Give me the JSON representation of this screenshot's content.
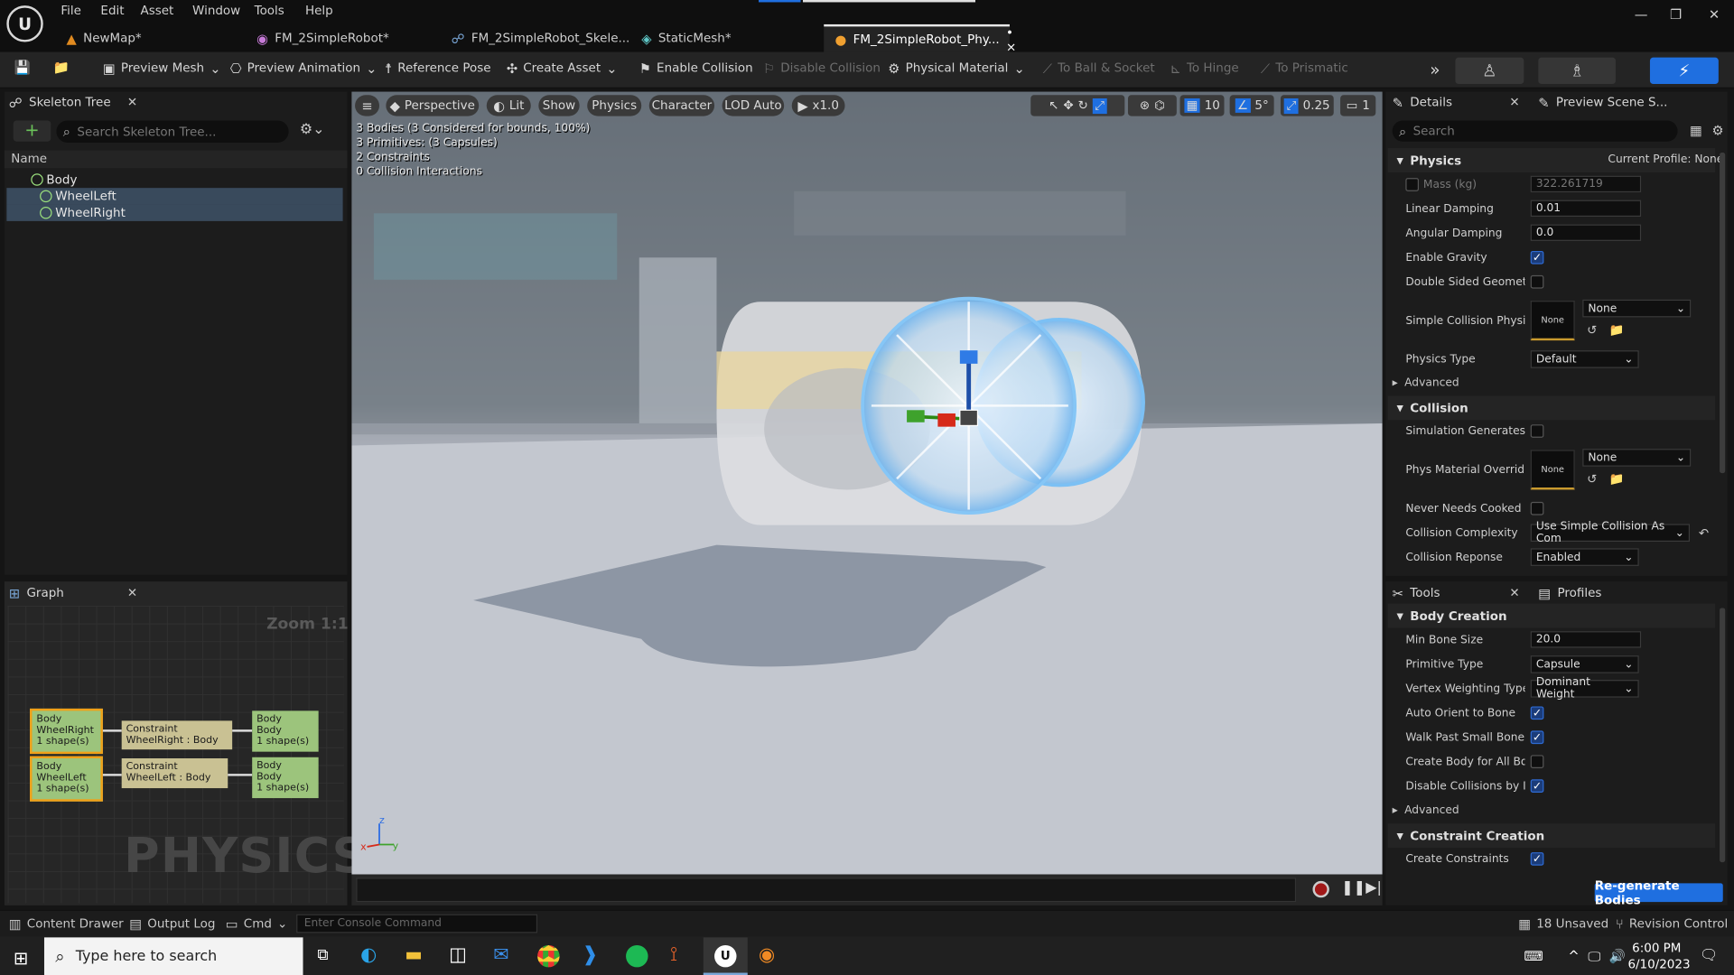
{
  "menu": [
    "File",
    "Edit",
    "Asset",
    "Window",
    "Tools",
    "Help"
  ],
  "doc_tabs": [
    {
      "label": "NewMap*",
      "icon": "map-icon",
      "active": false
    },
    {
      "label": "FM_2SimpleRobot*",
      "icon": "blueprint-icon",
      "active": false
    },
    {
      "label": "FM_2SimpleRobot_Skele...",
      "icon": "skeleton-icon",
      "active": false
    },
    {
      "label": "StaticMesh*",
      "icon": "staticmesh-icon",
      "active": false
    },
    {
      "label": "FM_2SimpleRobot_Phy...",
      "icon": "physics-asset-icon",
      "active": true,
      "suffix": "• ×"
    }
  ],
  "toolbar": {
    "preview_mesh": "Preview Mesh",
    "preview_animation": "Preview Animation",
    "reference_pose": "Reference Pose",
    "create_asset": "Create Asset",
    "enable_collision": "Enable Collision",
    "disable_collision": "Disable Collision",
    "physical_material": "Physical Material",
    "to_ball_socket": "To Ball & Socket",
    "to_hinge": "To Hinge",
    "to_prismatic": "To Prismatic"
  },
  "skeleton": {
    "tab": "Skeleton Tree",
    "search_placeholder": "Search Skeleton Tree...",
    "header": "Name",
    "bones": [
      {
        "name": "Body",
        "selected": false,
        "indent": 0
      },
      {
        "name": "WheelLeft",
        "selected": true,
        "indent": 1
      },
      {
        "name": "WheelRight",
        "selected": true,
        "indent": 1
      }
    ]
  },
  "graph": {
    "tab": "Graph",
    "zoom": "Zoom 1:1",
    "watermark": "PHYSICS",
    "rows": [
      {
        "left": [
          "Body",
          "WheelRight",
          "1 shape(s)"
        ],
        "mid": [
          "Constraint",
          "WheelRight : Body"
        ],
        "right": [
          "Body",
          "Body",
          "1 shape(s)"
        ]
      },
      {
        "left": [
          "Body",
          "WheelLeft",
          "1 shape(s)"
        ],
        "mid": [
          "Constraint",
          "WheelLeft : Body"
        ],
        "right": [
          "Body",
          "Body",
          "1 shape(s)"
        ]
      }
    ]
  },
  "viewport": {
    "perspective": "Perspective",
    "lit": "Lit",
    "show": "Show",
    "physics": "Physics",
    "character": "Character",
    "lod": "LOD Auto",
    "speed": "x1.0",
    "grid": "10",
    "angle": "5°",
    "scale": "0.25",
    "camera": "1",
    "stats": [
      "3 Bodies (3 Considered for bounds, 100%)",
      "3 Primitives: (3 Capsules)",
      "2 Constraints",
      "0 Collision Interactions"
    ]
  },
  "details": {
    "tab": "Details",
    "tab2": "Preview Scene S...",
    "search_placeholder": "Search",
    "physics_section": "Physics",
    "current_profile": "Current Profile: None",
    "mass_label": "Mass (kg)",
    "mass_value": "322.261719",
    "linear_damping_label": "Linear Damping",
    "linear_damping": "0.01",
    "angular_damping_label": "Angular Damping",
    "angular_damping": "0.0",
    "enable_gravity_label": "Enable Gravity",
    "double_sided_label": "Double Sided Geometry",
    "simple_collision_label": "Simple Collision Physi...",
    "none": "None",
    "physics_type_label": "Physics Type",
    "physics_type": "Default",
    "advanced": "Advanced",
    "collision_section": "Collision",
    "sim_generates_label": "Simulation Generates...",
    "phys_mat_override_label": "Phys Material Override",
    "never_needs_label": "Never Needs Cooked C...",
    "collision_complexity_label": "Collision Complexity",
    "collision_complexity": "Use Simple Collision As Com",
    "collision_response_label": "Collision Reponse",
    "collision_response": "Enabled"
  },
  "tools": {
    "tab": "Tools",
    "tab2": "Profiles",
    "body_creation": "Body Creation",
    "min_bone_size_label": "Min Bone Size",
    "min_bone_size": "20.0",
    "primitive_type_label": "Primitive Type",
    "primitive_type": "Capsule",
    "vertex_weighting_label": "Vertex Weighting Type",
    "vertex_weighting": "Dominant Weight",
    "auto_orient_label": "Auto Orient to Bone",
    "walk_past_label": "Walk Past Small Bones",
    "create_body_all_label": "Create Body for All Bo...",
    "disable_collisions_label": "Disable Collisions by D...",
    "advanced": "Advanced",
    "constraint_creation": "Constraint Creation",
    "create_constraints_label": "Create Constraints",
    "regenerate": "Re-generate Bodies"
  },
  "status": {
    "content_drawer": "Content Drawer",
    "output_log": "Output Log",
    "cmd": "Cmd",
    "console_placeholder": "Enter Console Command",
    "unsaved": "18 Unsaved",
    "revision": "Revision Control"
  },
  "taskbar": {
    "search_placeholder": "Type here to search",
    "time": "6:00 PM",
    "date": "6/10/2023"
  },
  "colors": {
    "accent": "#1f6fe0",
    "selected": "#394a5c",
    "node_green": "#9cc47c",
    "node_constraint": "#c9c193",
    "node_selected_border": "#f0a018"
  }
}
